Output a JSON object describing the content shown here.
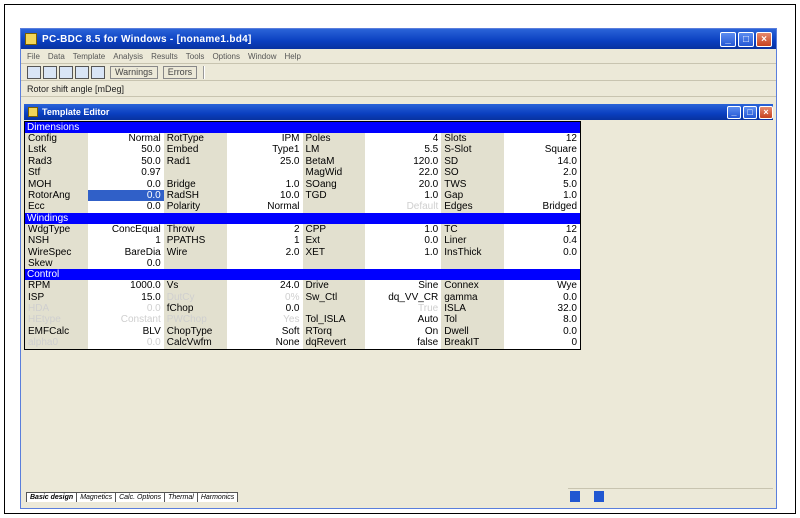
{
  "window": {
    "title": "PC-BDC 8.5 for Windows - [noname1.bd4]",
    "minimize": "_",
    "maximize": "□",
    "close": "×"
  },
  "menu": [
    "File",
    "Data",
    "Template",
    "Analysis",
    "Results",
    "Tools",
    "Options",
    "Window",
    "Help"
  ],
  "toolbar": {
    "warnings": "Warnings",
    "errors": "Errors"
  },
  "status_text": "Rotor shift angle [mDeg]",
  "editor": {
    "title": "Template Editor"
  },
  "sections": {
    "dimensions": "Dimensions",
    "windings": "Windings",
    "control": "Control"
  },
  "dimensions_rows": [
    [
      {
        "l": "Config",
        "v": "Normal"
      },
      {
        "l": "RotType",
        "v": "IPM"
      },
      {
        "l": "Poles",
        "v": "4"
      },
      {
        "l": "Slots",
        "v": "12"
      }
    ],
    [
      {
        "l": "Lstk",
        "v": "50.0"
      },
      {
        "l": "Embed",
        "v": "Type1"
      },
      {
        "l": "LM",
        "v": "5.5"
      },
      {
        "l": "S-Slot",
        "v": "Square"
      }
    ],
    [
      {
        "l": "Rad3",
        "v": "50.0"
      },
      {
        "l": "Rad1",
        "v": "25.0"
      },
      {
        "l": "BetaM",
        "v": "120.0"
      },
      {
        "l": "SD",
        "v": "14.0"
      }
    ],
    [
      {
        "l": "Stf",
        "v": "0.97"
      },
      {
        "l": "",
        "v": ""
      },
      {
        "l": "MagWid",
        "v": "22.0"
      },
      {
        "l": "SO",
        "v": "2.0"
      }
    ],
    [
      {
        "l": "MOH",
        "v": "0.0"
      },
      {
        "l": "Bridge",
        "v": "1.0"
      },
      {
        "l": "SOang",
        "v": "20.0"
      },
      {
        "l": "TWS",
        "v": "5.0"
      }
    ],
    [
      {
        "l": "RotorAng",
        "v": "0.0"
      },
      {
        "l": "RadSH",
        "v": "10.0"
      },
      {
        "l": "TGD",
        "v": "1.0"
      },
      {
        "l": "Gap",
        "v": "1.0"
      }
    ],
    [
      {
        "l": "Ecc",
        "v": "0.0"
      },
      {
        "l": "Polarity",
        "v": "Normal"
      },
      {
        "l": "",
        "v": "Default"
      },
      {
        "l": "Edges",
        "v": "Bridged"
      }
    ]
  ],
  "windings_rows": [
    [
      {
        "l": "WdgType",
        "v": "ConcEqual"
      },
      {
        "l": "Throw",
        "v": "2"
      },
      {
        "l": "CPP",
        "v": "1.0"
      },
      {
        "l": "TC",
        "v": "12"
      }
    ],
    [
      {
        "l": "NSH",
        "v": "1"
      },
      {
        "l": "PPATHS",
        "v": "1"
      },
      {
        "l": "Ext",
        "v": "0.0"
      },
      {
        "l": "Liner",
        "v": "0.4"
      }
    ],
    [
      {
        "l": "WireSpec",
        "v": "BareDia"
      },
      {
        "l": "Wire",
        "v": "2.0"
      },
      {
        "l": "XET",
        "v": "1.0"
      },
      {
        "l": "InsThick",
        "v": "0.0"
      }
    ],
    [
      {
        "l": "Skew",
        "v": "0.0"
      },
      {
        "l": "",
        "v": ""
      },
      {
        "l": "",
        "v": ""
      },
      {
        "l": "",
        "v": ""
      }
    ]
  ],
  "control_rows": [
    [
      {
        "l": "RPM",
        "v": "1000.0"
      },
      {
        "l": "Vs",
        "v": "24.0"
      },
      {
        "l": "Drive",
        "v": "Sine"
      },
      {
        "l": "Connex",
        "v": "Wye"
      }
    ],
    [
      {
        "l": "ISP",
        "v": "15.0"
      },
      {
        "l": "DutCy",
        "v": "0%"
      },
      {
        "l": "Sw_Ctl",
        "v": "dq_VV_CR"
      },
      {
        "l": "gamma",
        "v": "0.0"
      }
    ],
    [
      {
        "l": "HDA",
        "v": "0.0"
      },
      {
        "l": "fChop",
        "v": "0.0"
      },
      {
        "l": "",
        "v": "True"
      },
      {
        "l": "ISLA",
        "v": "32.0"
      }
    ],
    [
      {
        "l": "HEtype",
        "v": "Constant"
      },
      {
        "l": "PWChop",
        "v": "Yes"
      },
      {
        "l": "Tol_ISLA",
        "v": "Auto"
      },
      {
        "l": "Tol",
        "v": "8.0"
      }
    ],
    [
      {
        "l": "EMFCalc",
        "v": "BLV"
      },
      {
        "l": "ChopType",
        "v": "Soft"
      },
      {
        "l": "RTorq",
        "v": "On"
      },
      {
        "l": "Dwell",
        "v": "0.0"
      }
    ],
    [
      {
        "l": "alpha0",
        "v": "0.0"
      },
      {
        "l": "CalcVwfm",
        "v": "None"
      },
      {
        "l": "dqRevert",
        "v": "false"
      },
      {
        "l": "BreakIT",
        "v": "0"
      }
    ]
  ],
  "tabs": [
    "Basic design",
    "Magnetics",
    "Calc. Options",
    "Thermal",
    "Harmonics"
  ],
  "colors": {
    "section": "#0000ff",
    "titlebar": "#0a3fc0",
    "selected": "#3060c8"
  }
}
